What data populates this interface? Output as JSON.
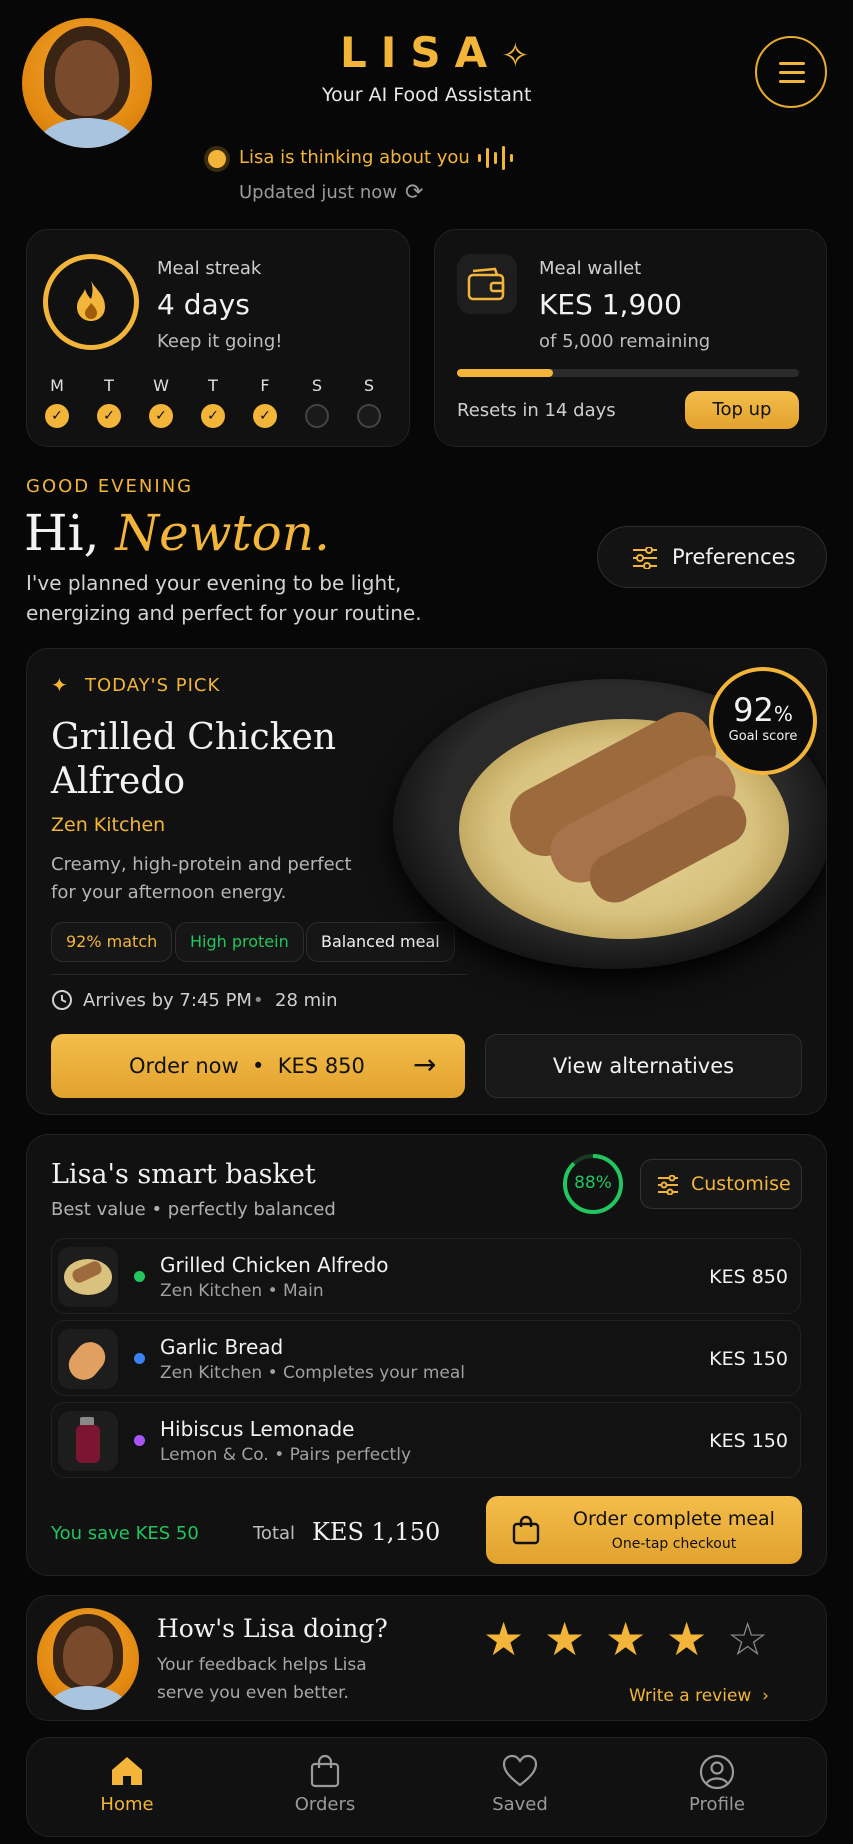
{
  "header": {
    "brand": "LISA",
    "brand_mark": "✧",
    "subtitle": "Your AI Food Assistant",
    "status": "Lisa is thinking about you",
    "updated": "Updated just now"
  },
  "streak": {
    "title": "Meal streak",
    "value": "4 days",
    "note": "Keep it going!",
    "days": [
      {
        "letter": "M",
        "done": true
      },
      {
        "letter": "T",
        "done": true
      },
      {
        "letter": "W",
        "done": true
      },
      {
        "letter": "T",
        "done": true
      },
      {
        "letter": "F",
        "done": true
      },
      {
        "letter": "S",
        "done": false
      },
      {
        "letter": "S",
        "done": false
      }
    ]
  },
  "wallet": {
    "title": "Meal wallet",
    "amount": "KES 1,900",
    "sub": "of 5,000 remaining",
    "progress_fraction": 0.28,
    "resets": "Resets in 14 days",
    "topup": "Top up"
  },
  "greeting": {
    "eyebrow": "GOOD EVENING",
    "hi": "Hi,",
    "name": "Newton.",
    "line1": "I've planned your evening to be light,",
    "line2": "energizing and perfect for your routine.",
    "preferences": "Preferences"
  },
  "pick": {
    "eyebrow": "TODAY'S PICK",
    "title_line1": "Grilled Chicken",
    "title_line2": "Alfredo",
    "restaurant": "Zen Kitchen",
    "desc_line1": "Creamy, high-protein and perfect",
    "desc_line2": "for your afternoon energy.",
    "tags": [
      "92% match",
      "High protein",
      "Balanced meal"
    ],
    "arrival": "Arrives by 7:45 PM",
    "duration": "28 min",
    "order": "Order now",
    "price": "KES 850",
    "alternatives": "View alternatives",
    "score_value": "92",
    "score_unit": "%",
    "score_label": "Goal score"
  },
  "basket": {
    "title": "Lisa's smart basket",
    "subtitle": "Best value • perfectly balanced",
    "score": "88%",
    "customise": "Customise",
    "items": [
      {
        "name": "Grilled Chicken Alfredo",
        "meta": "Zen Kitchen • Main",
        "price": "KES 850",
        "dot": "#22c55e"
      },
      {
        "name": "Garlic Bread",
        "meta": "Zen Kitchen • Completes your meal",
        "price": "KES 150",
        "dot": "#3b82f6"
      },
      {
        "name": "Hibiscus Lemonade",
        "meta": "Lemon & Co. • Pairs perfectly",
        "price": "KES 150",
        "dot": "#a855f7"
      }
    ],
    "savings": "You save KES 50",
    "total_label": "Total",
    "total": "KES 1,150",
    "checkout": "Order complete meal",
    "checkout_sub": "One-tap checkout"
  },
  "feedback": {
    "title": "How's Lisa doing?",
    "line1": "Your feedback helps Lisa",
    "line2": "serve you even better.",
    "rating": 4,
    "max_rating": 5,
    "review": "Write a review"
  },
  "nav": {
    "items": [
      "Home",
      "Orders",
      "Saved",
      "Profile"
    ],
    "active": "Home"
  },
  "colors": {
    "accent": "#f2b53a",
    "background": "#070707",
    "success": "#22c55e"
  }
}
